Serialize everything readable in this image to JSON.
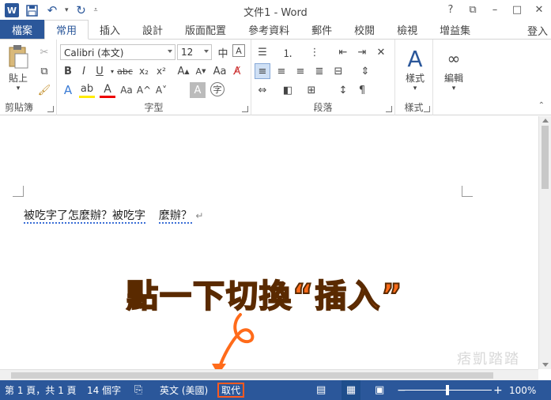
{
  "app": {
    "title": "文件1 - Word",
    "logo_letter": "W",
    "signin": "登入"
  },
  "qat": {
    "save_icon": "save-icon",
    "undo_icon": "undo-icon",
    "redo_icon": "redo-icon"
  },
  "tabs": [
    {
      "label": "檔案"
    },
    {
      "label": "常用"
    },
    {
      "label": "插入"
    },
    {
      "label": "設計"
    },
    {
      "label": "版面配置"
    },
    {
      "label": "參考資料"
    },
    {
      "label": "郵件"
    },
    {
      "label": "校閱"
    },
    {
      "label": "檢視"
    },
    {
      "label": "增益集"
    }
  ],
  "ribbon": {
    "clipboard": {
      "label": "剪貼簿",
      "paste_label": "貼上"
    },
    "font": {
      "label": "字型",
      "font_name": "Calibri (本文)",
      "font_size": "12"
    },
    "paragraph": {
      "label": "段落"
    },
    "styles": {
      "label": "樣式",
      "styles_button": "樣式"
    },
    "editing": {
      "label": "",
      "editing_button": "編輯"
    }
  },
  "document": {
    "text_part1": "被吃字了怎麼辦？被吃字",
    "text_part2": "麼辦？",
    "para_mark": "↵"
  },
  "annotation": "點一下切換“插入”",
  "watermark": "痞凱踏踏",
  "status": {
    "page": "第 1 頁，共 1 頁",
    "words": "14 個字",
    "language": "英文 (美國)",
    "mode": "取代",
    "zoom": "100%",
    "zoom_minus": "−",
    "zoom_plus": "+"
  },
  "colors": {
    "brand": "#2b579a",
    "annotation": "#ff6b1a",
    "highlight_box": "#ff5a1f"
  }
}
